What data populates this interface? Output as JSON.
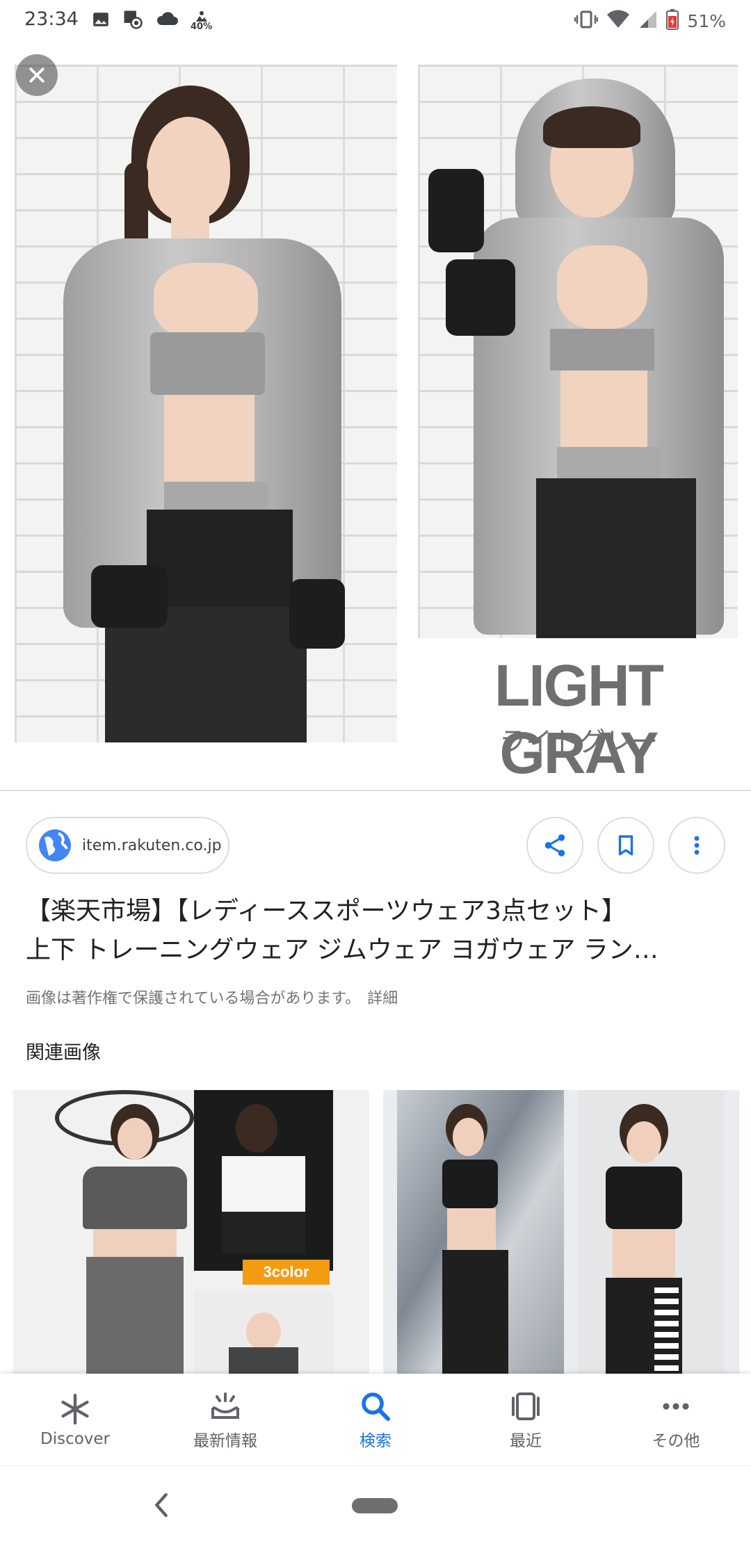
{
  "status_bar": {
    "time": "23:34",
    "data_saver_label": "40%",
    "battery_percent": "51%",
    "icons": [
      "image-icon",
      "screen-record-icon",
      "cloud-icon",
      "data-saver-icon",
      "vibrate-icon",
      "wifi-icon",
      "signal-icon",
      "battery-icon"
    ]
  },
  "hero": {
    "caption_en": "LIGHT GRAY",
    "caption_jp": "ライトグレー",
    "close_icon": "close-icon"
  },
  "result": {
    "source_domain": "item.rakuten.co.jp",
    "title_line1": "【楽天市場】【レディーススポーツウェア3点セット】",
    "title_line2": "上下 トレーニングウェア ジムウェア ヨガウェア ラン…",
    "copyright_notice": "画像は著作権で保護されている場合があります。",
    "detail_link": "詳細",
    "actions": [
      "share-icon",
      "bookmark-icon",
      "more-vert-icon"
    ]
  },
  "related": {
    "heading": "関連画像",
    "thumb1_badge": "3color"
  },
  "bottom_nav": {
    "items": [
      {
        "label": "Discover",
        "icon": "asterisk-icon",
        "active": false
      },
      {
        "label": "最新情報",
        "icon": "updates-icon",
        "active": false
      },
      {
        "label": "検索",
        "icon": "search-icon",
        "active": true
      },
      {
        "label": "最近",
        "icon": "recent-icon",
        "active": false
      },
      {
        "label": "その他",
        "icon": "more-horiz-icon",
        "active": false
      }
    ]
  },
  "colors": {
    "accent": "#1a73e8",
    "text_primary": "#202124",
    "text_secondary": "#70757a",
    "divider": "#dadce0"
  }
}
